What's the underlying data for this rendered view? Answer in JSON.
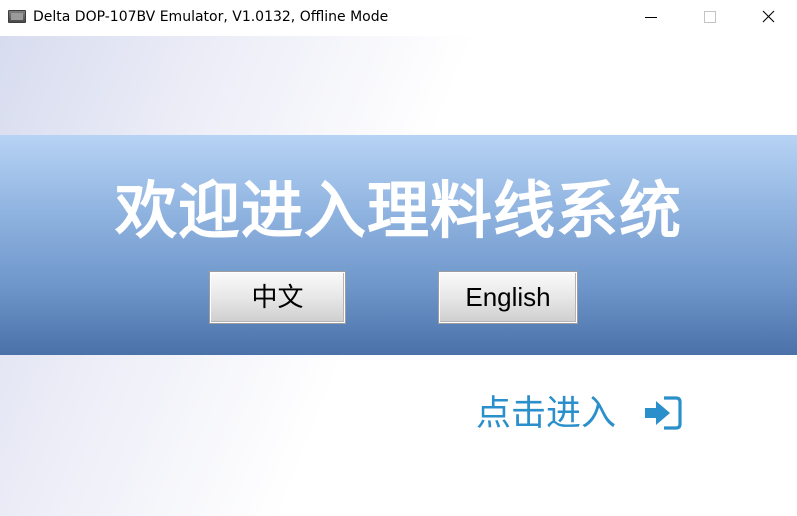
{
  "window": {
    "title": "Delta DOP-107BV Emulator, V1.0132, Offline Mode",
    "icon": "monitor-icon",
    "controls": [
      "minimize-icon",
      "maximize-icon",
      "close-icon"
    ]
  },
  "banner": {
    "title": "欢迎进入理料线系统"
  },
  "language_buttons": {
    "chinese_label": "中文",
    "english_label": "English"
  },
  "enter": {
    "label": "点击进入",
    "icon": "login-arrow-icon"
  },
  "colors": {
    "banner_top": "#b7d3f4",
    "banner_bottom": "#4a72a9",
    "enter_text": "#2b8fcb",
    "enter_icon": "#2b8fcb"
  }
}
